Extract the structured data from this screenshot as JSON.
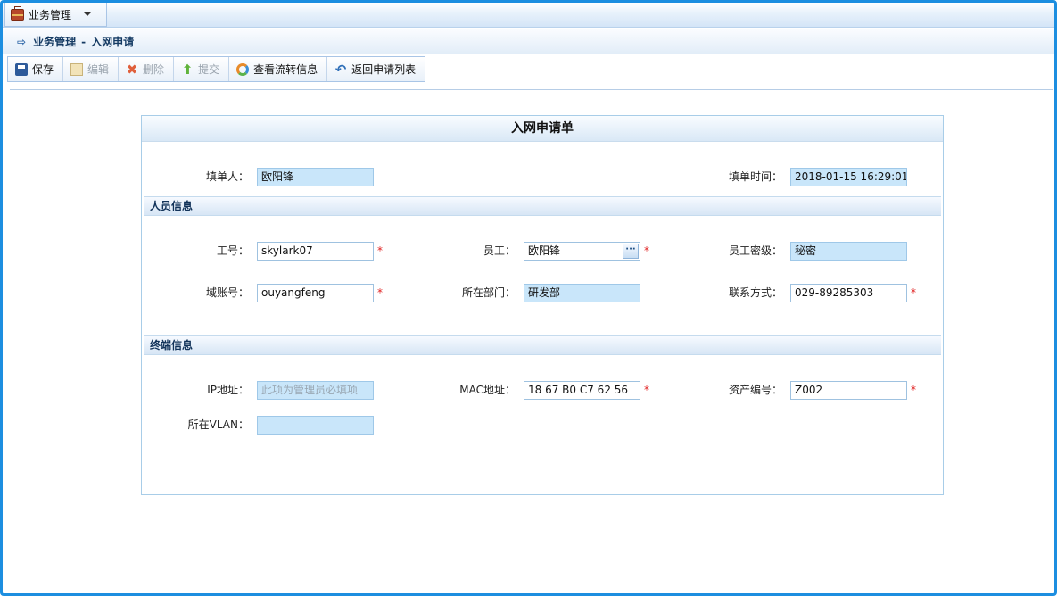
{
  "menu": {
    "label": "业务管理"
  },
  "breadcrumb": {
    "module": "业务管理",
    "separator": "-",
    "page": "入网申请"
  },
  "toolbar": {
    "save": "保存",
    "edit": "编辑",
    "delete": "删除",
    "submit": "提交",
    "flow": "查看流转信息",
    "back": "返回申请列表"
  },
  "form": {
    "title": "入网申请单",
    "filler": {
      "label": "填单人：",
      "value": "欧阳锋"
    },
    "fill_time": {
      "label": "填单时间：",
      "value": "2018-01-15 16:29:01"
    },
    "person_section": "人员信息",
    "job_no": {
      "label": "工号：",
      "value": "skylark07"
    },
    "employee": {
      "label": "员工：",
      "value": "欧阳锋"
    },
    "security_level": {
      "label": "员工密级：",
      "value": "秘密"
    },
    "domain_account": {
      "label": "域账号：",
      "value": "ouyangfeng"
    },
    "department": {
      "label": "所在部门：",
      "value": "研发部"
    },
    "contact": {
      "label": "联系方式：",
      "value": "029-89285303"
    },
    "terminal_section": "终端信息",
    "ip": {
      "label": "IP地址：",
      "placeholder": "此项为管理员必填项"
    },
    "mac": {
      "label": "MAC地址：",
      "value": "18 67 B0 C7 62 56"
    },
    "asset_no": {
      "label": "资产编号：",
      "value": "Z002"
    },
    "vlan": {
      "label": "所在VLAN：",
      "value": ""
    }
  },
  "required_mark": "*",
  "lookup_glyph": "···",
  "colors": {
    "frame": "#1c8ee0",
    "readonly_field": "#c9e6fa",
    "required": "#e02020"
  }
}
